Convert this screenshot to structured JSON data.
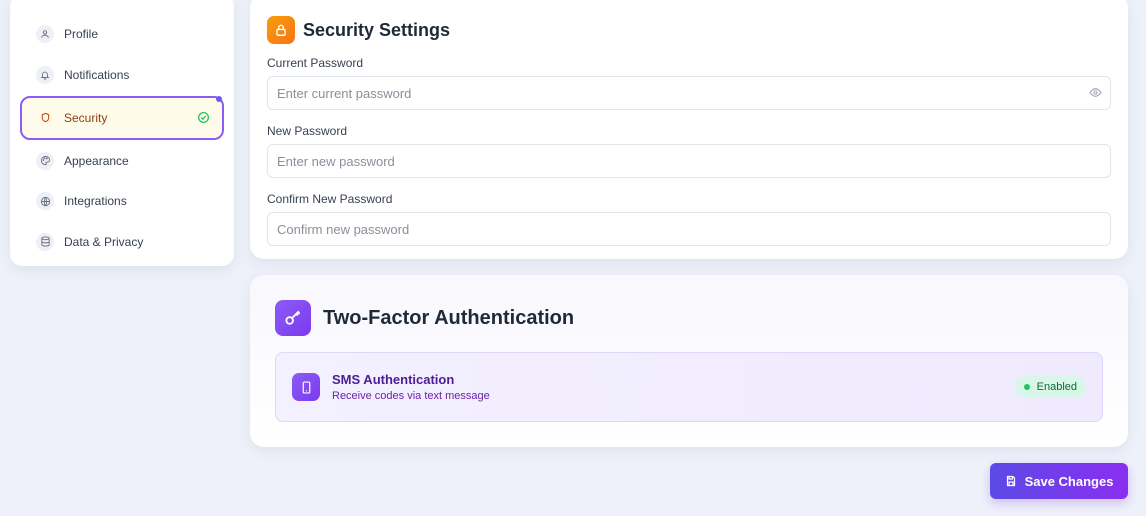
{
  "sidebar": {
    "items": [
      {
        "label": "Profile",
        "icon": "user-icon"
      },
      {
        "label": "Notifications",
        "icon": "bell-icon"
      },
      {
        "label": "Security",
        "icon": "shield-icon",
        "active": true
      },
      {
        "label": "Appearance",
        "icon": "palette-icon"
      },
      {
        "label": "Integrations",
        "icon": "globe-icon"
      },
      {
        "label": "Data & Privacy",
        "icon": "database-icon"
      }
    ]
  },
  "security": {
    "title": "Security Settings",
    "icon": "lock-icon",
    "current_label": "Current Password",
    "current_placeholder": "Enter current password",
    "new_label": "New Password",
    "new_placeholder": "Enter new password",
    "confirm_label": "Confirm New Password",
    "confirm_placeholder": "Confirm new password"
  },
  "tfa": {
    "title": "Two-Factor Authentication",
    "icon": "key-icon",
    "method_title": "SMS Authentication",
    "method_desc": "Receive codes via text message",
    "method_icon": "smartphone-icon",
    "status": "Enabled"
  },
  "actions": {
    "save_label": "Save Changes",
    "save_icon": "save-icon"
  },
  "colors": {
    "accent": "#8b5cf6",
    "orange": "#f59e0b",
    "success": "#22c55e"
  }
}
